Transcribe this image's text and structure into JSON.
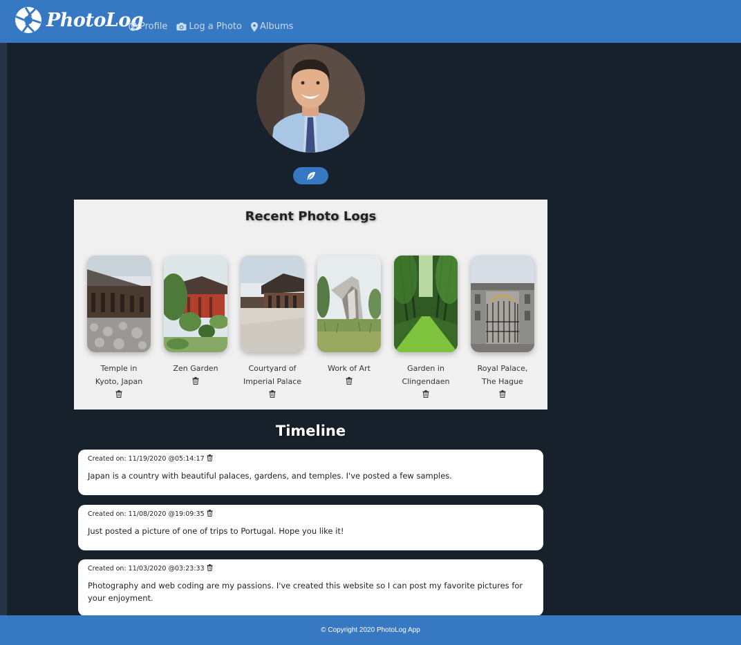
{
  "app": {
    "brand_name": "PhotoLog"
  },
  "nav": [
    {
      "label": "Profile",
      "icon": "user-circle-icon"
    },
    {
      "label": "Log a Photo",
      "icon": "camera-icon"
    },
    {
      "label": "Albums",
      "icon": "map-marker-icon"
    }
  ],
  "profile": {
    "edit_icon": "feather-icon"
  },
  "recent": {
    "title": "Recent Photo Logs",
    "cards": [
      {
        "caption": "Temple in Kyoto, Japan"
      },
      {
        "caption": "Zen Garden"
      },
      {
        "caption": "Courtyard of Imperial Palace"
      },
      {
        "caption": "Work of Art"
      },
      {
        "caption": "Garden in Clingendaen"
      },
      {
        "caption": "Royal Palace, The Hague"
      }
    ]
  },
  "timeline": {
    "title": "Timeline",
    "posts": [
      {
        "meta": "Created on: 11/19/2020 @05:14:17",
        "body": "Japan is a country with beautiful palaces, gardens, and temples. I've posted a few samples."
      },
      {
        "meta": "Created on: 11/08/2020 @19:09:35",
        "body": "Just posted a picture of one of trips to Portugal. Hope you like it!"
      },
      {
        "meta": "Created on: 11/03/2020 @03:23:33",
        "body": "Photography and web coding are my passions. I've created this website so I can post my favorite pictures for your enjoyment."
      }
    ]
  },
  "footer": {
    "text": "© Copyright 2020 PhotoLog App"
  },
  "colors": {
    "primary": "#3678c2",
    "background": "#17212b",
    "panel": "#f0f0f0"
  }
}
